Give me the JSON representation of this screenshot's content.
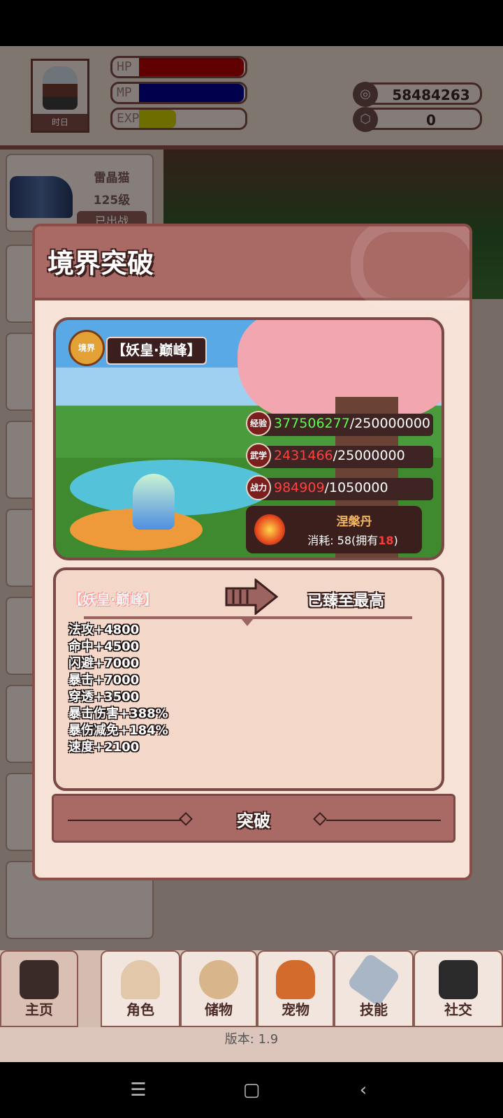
{
  "player": {
    "name": "时日",
    "hp_label": "HP",
    "mp_label": "MP",
    "exp_label": "EXP",
    "hp_fill": 1.0,
    "mp_fill": 1.0,
    "exp_fill": 0.35
  },
  "currency": {
    "coins": "58484263",
    "gems": "0",
    "coin_icon": "coin-icon",
    "gem_icon": "gem-icon"
  },
  "pet": {
    "name": "雷晶猫",
    "level": "125级",
    "status": "已出战"
  },
  "modal": {
    "title": "境界突破",
    "realm_badge": "境界",
    "realm_tag": "【妖皇·巅峰】",
    "stats": [
      {
        "icon": "经验",
        "current": "377506277",
        "required": "/250000000"
      },
      {
        "icon": "武学",
        "current": "2431466",
        "required": "/25000000"
      },
      {
        "icon": "战力",
        "current": "984909",
        "required": "/1050000"
      }
    ],
    "pill": {
      "name": "涅槃丹",
      "cost_prefix": "消耗: 58(拥有",
      "owned": "18",
      "cost_suffix": ")"
    },
    "current_realm": "【妖皇·巅峰】",
    "next_realm": "已臻至最高",
    "bonuses": [
      "法攻+4800",
      "命中+4500",
      "闪避+7000",
      "暴击+7000",
      "穿透+3500",
      "暴击伤害+388%",
      "暴伤减免+184%",
      "速度+2100"
    ],
    "button_label": "突破"
  },
  "nav": {
    "items": [
      {
        "label": "主页",
        "icon": "home-gate-icon"
      },
      {
        "label": "角色",
        "icon": "character-icon"
      },
      {
        "label": "储物",
        "icon": "storage-bag-icon"
      },
      {
        "label": "宠物",
        "icon": "pet-fox-icon"
      },
      {
        "label": "技能",
        "icon": "sword-icon"
      },
      {
        "label": "社交",
        "icon": "handshake-icon"
      }
    ],
    "version": "版本: 1.9"
  },
  "colors": {
    "accent": "#a96a66",
    "border": "#7a4845",
    "hp": "#b00000",
    "mp": "#00008b",
    "exp": "#c8c800"
  }
}
